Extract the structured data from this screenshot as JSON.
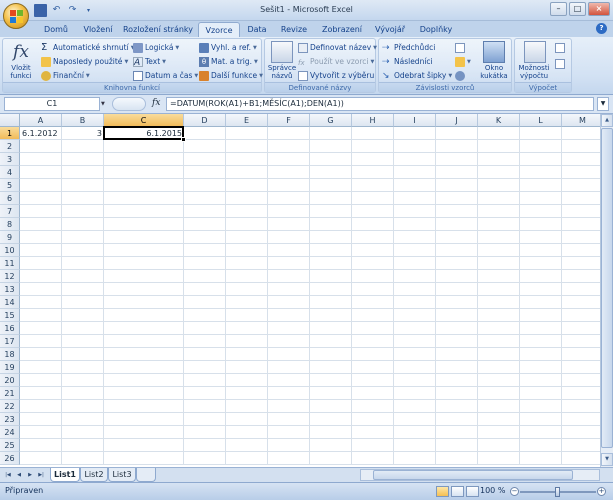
{
  "window": {
    "title": "Sešit1 - Microsoft Excel",
    "minimize": "–",
    "maximize": "□",
    "close": "×"
  },
  "ribbon_tabs": [
    "Domů",
    "Vložení",
    "Rozložení stránky",
    "Vzorce",
    "Data",
    "Revize",
    "Zobrazení",
    "Vývojář",
    "Doplňky"
  ],
  "active_tab": "Vzorce",
  "ribbon": {
    "function_library": {
      "label": "Knihovna funkcí",
      "insert_function": "Vložit funkci",
      "autosum": "Automatické shrnutí",
      "recently_used": "Naposledy použité",
      "financial": "Finanční",
      "logical": "Logická",
      "text": "Text",
      "date_time": "Datum a čas",
      "lookup": "Vyhl. a ref.",
      "math": "Mat. a trig.",
      "more": "Další funkce"
    },
    "defined_names": {
      "label": "Definované názvy",
      "name_manager": "Správce názvů",
      "define_name": "Definovat název",
      "use_in_formula": "Použít ve vzorci",
      "create_from_selection": "Vytvořit z výběru"
    },
    "formula_auditing": {
      "label": "Závislosti vzorců",
      "trace_precedents": "Předchůdci",
      "trace_dependents": "Následníci",
      "remove_arrows": "Odebrat šipky",
      "watch_window": "Okno kukátka"
    },
    "calculation": {
      "label": "Výpočet",
      "calc_options": "Možnosti výpočtu"
    }
  },
  "formula_bar": {
    "name_box": "C1",
    "fx": "fx",
    "formula": "=DATUM(ROK(A1)+B1;MĚSÍC(A1);DEN(A1))"
  },
  "columns": [
    "A",
    "B",
    "C",
    "D",
    "E",
    "F",
    "G",
    "H",
    "I",
    "J",
    "K",
    "L",
    "M"
  ],
  "selected_column": "C",
  "rows": [
    "1",
    "2",
    "3",
    "4",
    "5",
    "6",
    "7",
    "8",
    "9",
    "10",
    "11",
    "12",
    "13",
    "14",
    "15",
    "16",
    "17",
    "18",
    "19",
    "20",
    "21",
    "22",
    "23",
    "24",
    "25",
    "26"
  ],
  "selected_row": "1",
  "cells": {
    "A1": "6.1.2012",
    "B1": "3",
    "C1": "6.1.2015"
  },
  "active_cell": "C1",
  "sheet_tabs": [
    "List1",
    "List2",
    "List3"
  ],
  "active_sheet": "List1",
  "status": {
    "ready": "Připraven",
    "zoom": "100 %"
  },
  "colors": {
    "accent": "#15428b",
    "selected_header": "#f1bb5a",
    "ribbon_bg": "#d2e1f3"
  }
}
